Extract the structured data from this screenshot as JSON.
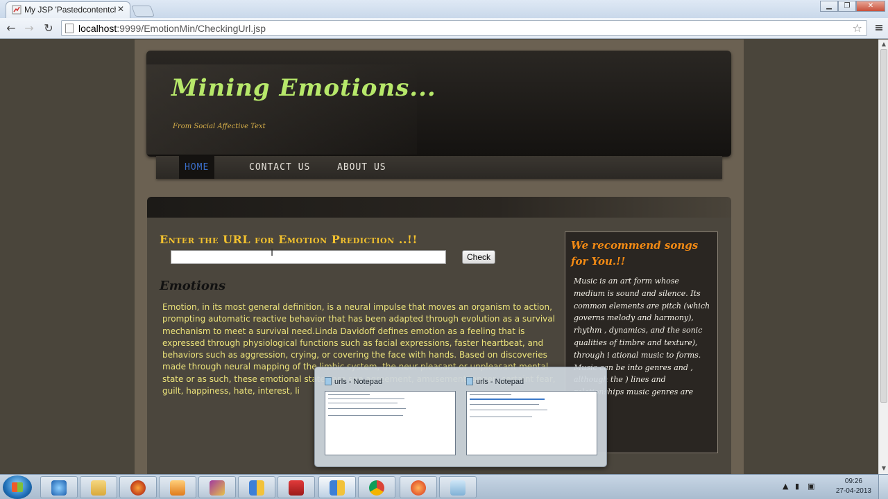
{
  "browser": {
    "tab_title": "My JSP 'Pastedcontentche",
    "tab_close": "✕",
    "url_host": "localhost",
    "url_path": ":9999/EmotionMin/CheckingUrl.jsp",
    "star": "☆",
    "back": "←",
    "forward": "→",
    "reload": "↻",
    "minimize": "▁",
    "maximize": "❐",
    "close": "✕"
  },
  "site": {
    "logo": "Mining Emotions...",
    "tagline": "From Social Affective Text",
    "nav": [
      "HOME",
      "CONTACT US",
      "ABOUT US"
    ]
  },
  "main": {
    "prompt": "Enter the URL for Emotion Prediction ..!!",
    "url_input_value": "",
    "check_label": "Check",
    "emotions_title": "Emotions",
    "paragraph": "Emotion, in its most general definition, is a neural impulse that moves an organism to action, prompting automatic reactive behavior that has been adapted through evolution as a survival mechanism to meet a survival need.Linda Davidoff defines emotion as a feeling that is expressed through physiological functions such as facial expressions, faster heartbeat, and behaviors such as aggression, crying, or covering the face with hands. Based on discoveries made through neural mapping of the limbic system, the neur pleasant or unpleasant mental state or as such, these emotional states are spe agreement, amusement, anger, certaint fear, guilt, happiness, hate, interest, li"
  },
  "sidebar": {
    "title": "We recommend songs for You.!!",
    "text": "Music is an art form whose medium is sound and silence. Its common elements are pitch (which governs melody and harmony), rhythm , dynamics, and the sonic qualities of timbre and texture), through i ational music to forms. Music can be into genres and , although the ) lines and relationships music genres are often"
  },
  "thumbnails": [
    {
      "title": "urls - Notepad"
    },
    {
      "title": "urls - Notepad"
    }
  ],
  "taskbar": {
    "time": "09:26",
    "date": "27-04-2013"
  },
  "colors": {
    "logo": "#b7e86a",
    "prompt": "#f2c12e",
    "sidebar_title": "#f28a14",
    "paragraph": "#ebe27a",
    "nav_active": "#3a6ec9"
  }
}
